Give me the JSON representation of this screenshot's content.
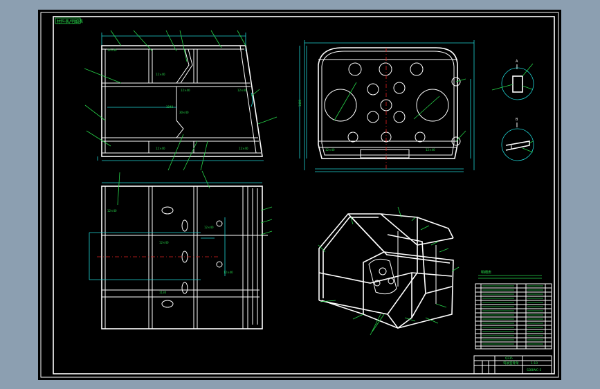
{
  "drawing": {
    "header_tag": "材料表/明细表",
    "section_a_label": "A",
    "section_b_label": "B",
    "table_title": "明细表",
    "title_block": {
      "name": "驾驶室骨架",
      "scale": "1:10",
      "drawing_no": "SDBWC-5",
      "material": "Q235"
    }
  },
  "colors": {
    "background": "#000000",
    "outline": "#ffffff",
    "dimension": "#1fd6d6",
    "leader": "#27d64a",
    "centerline": "#e02020",
    "frame": "#8c9fb1"
  }
}
